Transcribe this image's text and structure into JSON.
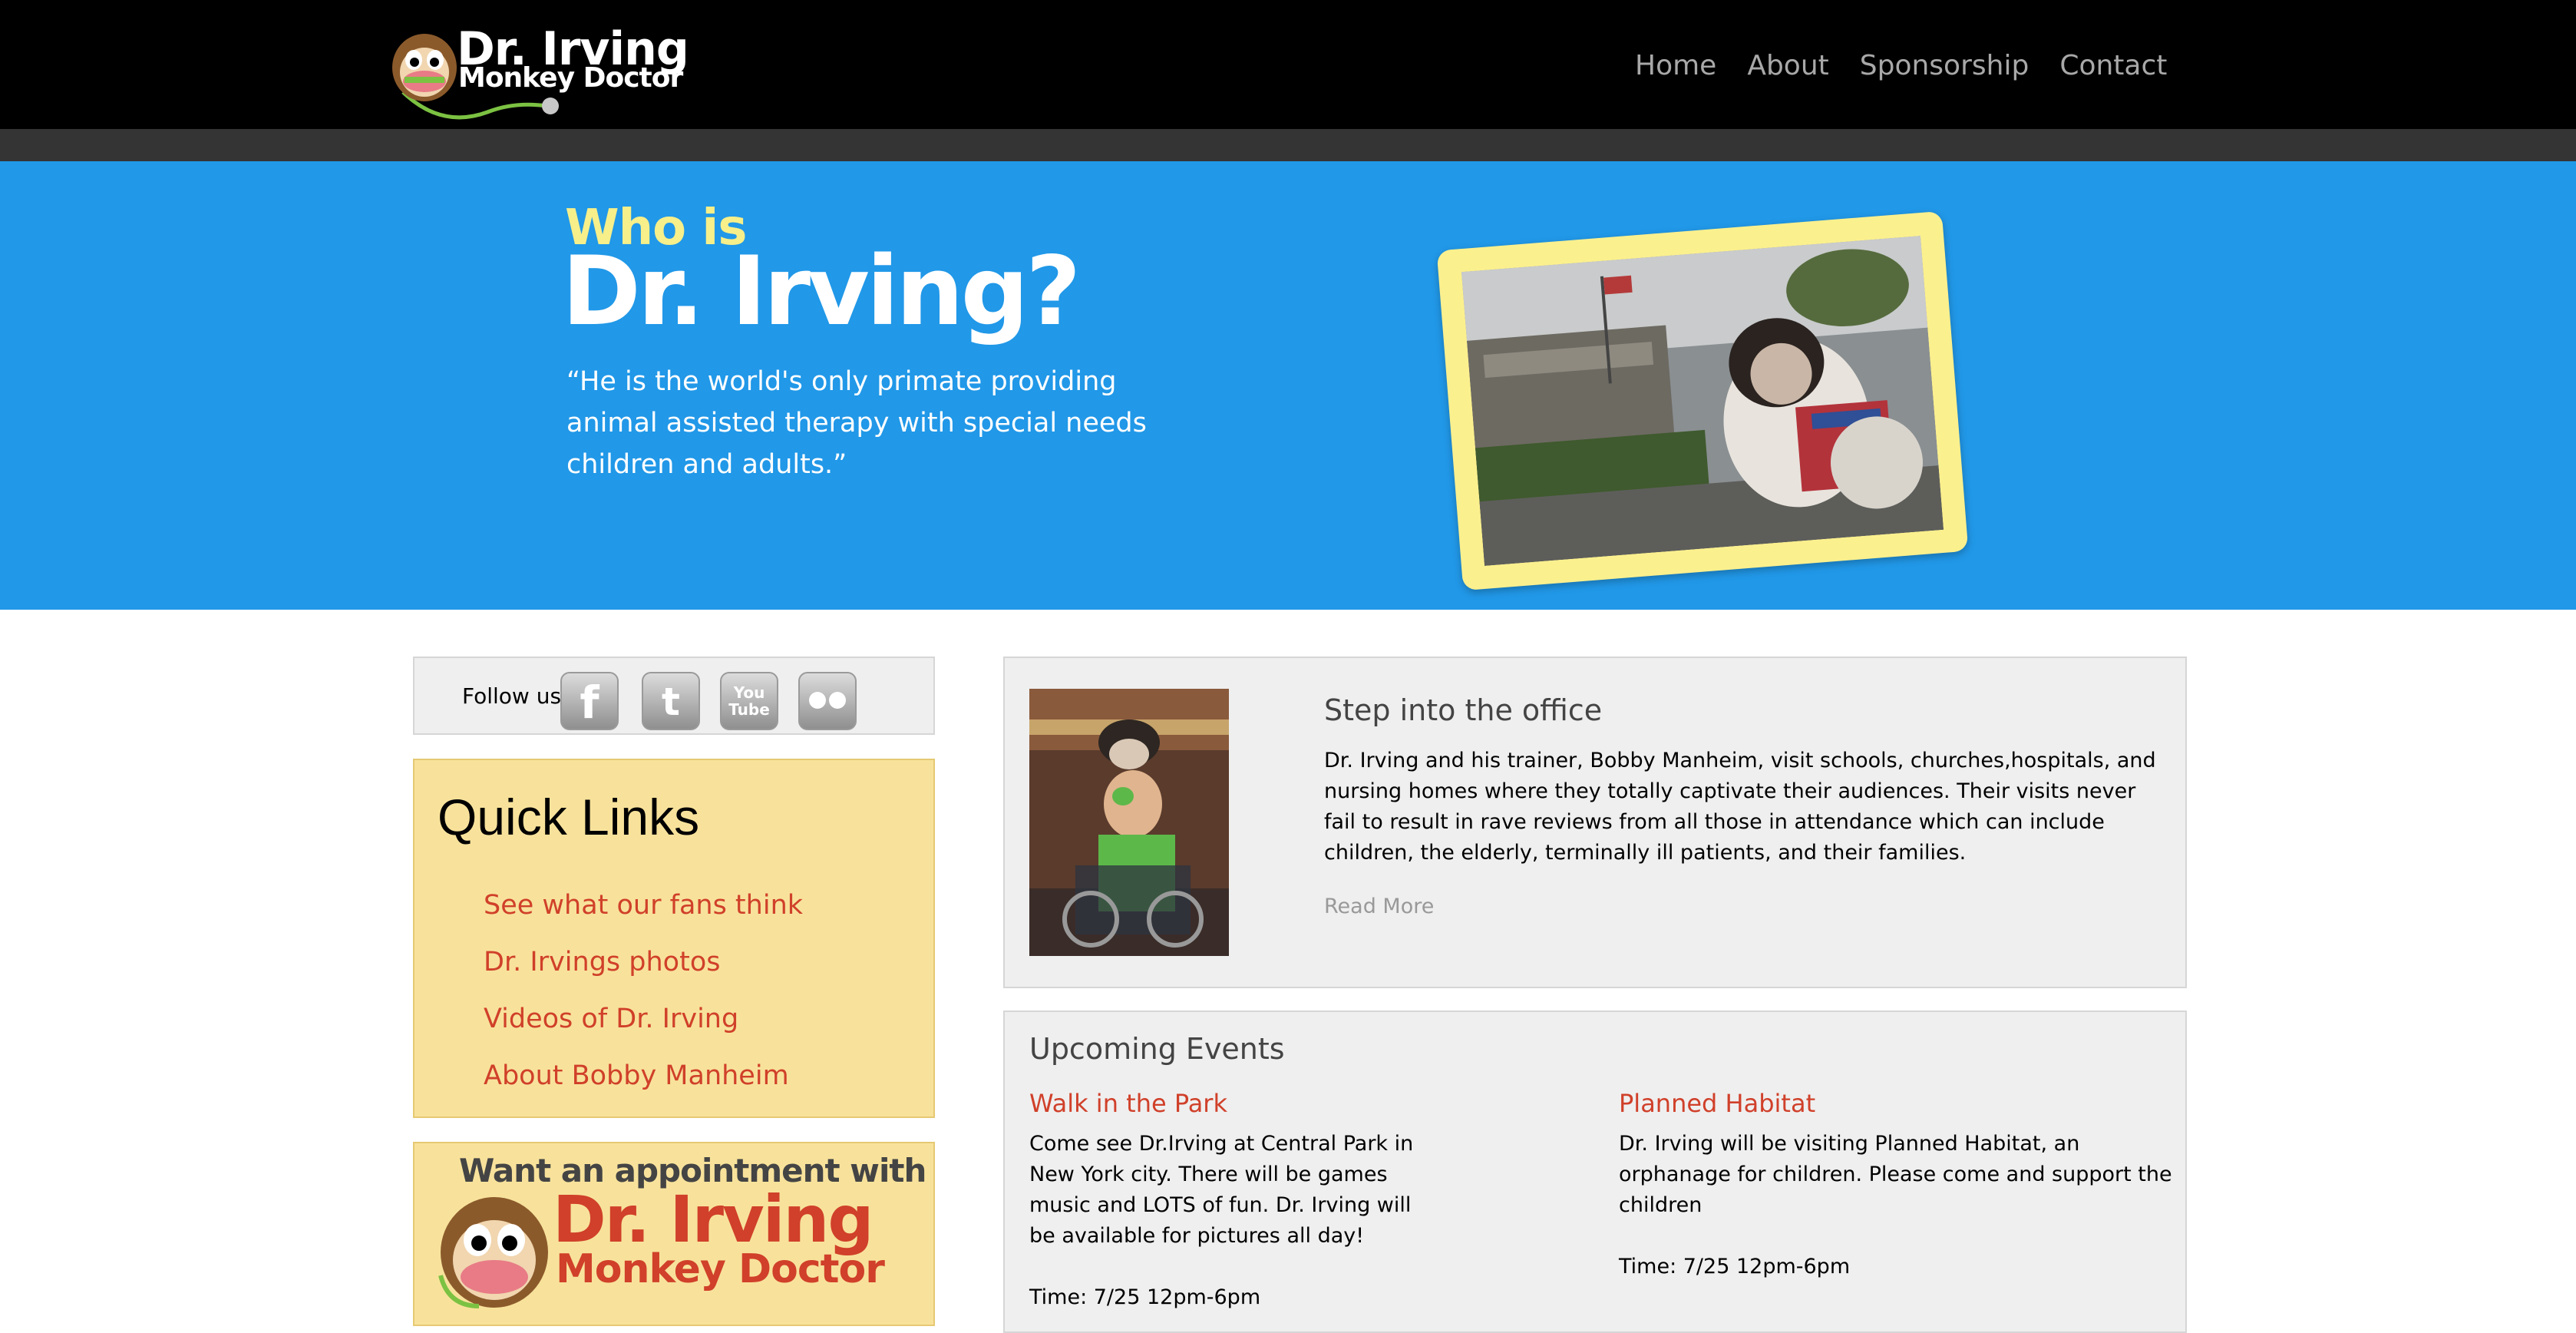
{
  "header": {
    "logo": {
      "title": "Dr. Irving",
      "subtitle": "Monkey Doctor"
    },
    "nav": [
      "Home",
      "About",
      "Sponsorship",
      "Contact"
    ]
  },
  "hero": {
    "heading_small": "Who is",
    "heading_large": "Dr. Irving?",
    "quote": "“He is the world's only primate providing animal assisted therapy with special needs children and adults.”",
    "frame_color": "#fbf08e",
    "background_color": "#2198e8"
  },
  "sidebar": {
    "follow_label": "Follow us",
    "social_icons": [
      "facebook-icon",
      "twitter-icon",
      "youtube-icon",
      "flickr-icon"
    ],
    "quick_links": {
      "title": "Quick Links",
      "items": [
        "See what our fans think",
        "Dr. Irvings photos",
        "Videos of Dr. Irving",
        "About Bobby Manheim"
      ]
    },
    "appointment": {
      "line1": "Want an appointment with",
      "line2": "Dr. Irving",
      "line3": "Monkey Doctor"
    }
  },
  "main": {
    "office": {
      "title": "Step into the office",
      "body": "Dr. Irving and his trainer, Bobby Manheim, visit schools, churches,hospitals, and nursing homes where they totally captivate their audiences. Their visits never fail to result in rave reviews from all those in attendance which can include children, the elderly, terminally ill patients, and their families.",
      "read_more": "Read More"
    },
    "events": {
      "title": "Upcoming Events",
      "items": [
        {
          "title": "Walk in the Park",
          "body": "Come see Dr.Irving at Central Park in New York city. There will be games music and LOTS of fun. Dr. Irving will be available for pictures all day!",
          "time": "Time: 7/25 12pm-6pm"
        },
        {
          "title": "Planned Habitat",
          "body": "Dr. Irving will be visiting Planned Habitat, an orphanage for children. Please come and support the children",
          "time": "Time: 7/25 12pm-6pm"
        }
      ]
    }
  },
  "colors": {
    "accent_red": "#d0402a",
    "quick_links_bg": "#f8e29b",
    "panel_bg": "#efefef",
    "nav_text": "#a8a8a8"
  }
}
